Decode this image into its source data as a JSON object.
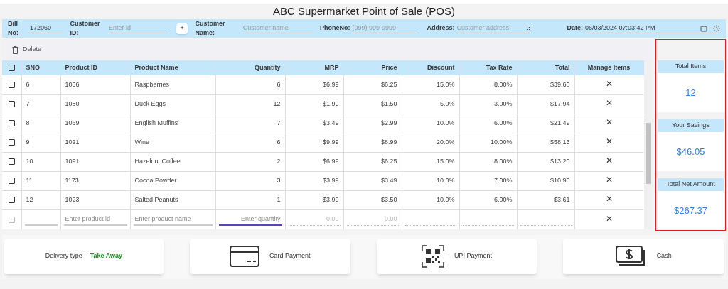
{
  "window": {
    "title": "ABC Supermarket Point of Sale (POS)"
  },
  "header": {
    "fields": [
      {
        "label": "Bill No:",
        "value": "172060"
      },
      {
        "label": "Customer ID:",
        "placeholder": "Enter id"
      },
      {
        "label": "Customer Name:",
        "placeholder": "Customer name"
      },
      {
        "label": "PhoneNo:",
        "placeholder": "(999) 999-9999"
      },
      {
        "label": "Address:",
        "placeholder": "Customer address"
      },
      {
        "label": "Date:",
        "value": "06/03/2024 07:03:42 PM"
      }
    ],
    "add_button": "+"
  },
  "toolbar": {
    "delete": "Delete"
  },
  "table": {
    "select_all": {
      "checked": false
    },
    "columns": [
      "SNO",
      "Product ID",
      "Product Name",
      "Quantity",
      "MRP",
      "Price",
      "Discount",
      "Tax Rate",
      "Total",
      "Manage Items"
    ],
    "rows": [
      {
        "checked": false,
        "cells": [
          "6",
          "1036",
          "Raspberries",
          "6",
          "$6.99",
          "$6.25",
          "15.0%",
          "8.00%",
          "$39.60"
        ],
        "remove": "✕"
      },
      {
        "checked": false,
        "cells": [
          "7",
          "1080",
          "Duck Eggs",
          "12",
          "$1.99",
          "$1.50",
          "5.0%",
          "3.00%",
          "$17.94"
        ],
        "remove": "✕"
      },
      {
        "checked": false,
        "cells": [
          "8",
          "1069",
          "English Muffins",
          "7",
          "$3.49",
          "$2.99",
          "10.0%",
          "6.00%",
          "$21.49"
        ],
        "remove": "✕"
      },
      {
        "checked": false,
        "cells": [
          "9",
          "1021",
          "Wine",
          "6",
          "$9.99",
          "$8.99",
          "20.0%",
          "10.00%",
          "$58.13"
        ],
        "remove": "✕"
      },
      {
        "checked": false,
        "cells": [
          "10",
          "1091",
          "Hazelnut Coffee",
          "2",
          "$6.99",
          "$6.25",
          "15.0%",
          "8.00%",
          "$13.20"
        ],
        "remove": "✕"
      },
      {
        "checked": false,
        "cells": [
          "11",
          "1173",
          "Cocoa Powder",
          "3",
          "$3.99",
          "$3.49",
          "10.0%",
          "7.00%",
          "$10.90"
        ],
        "remove": "✕"
      },
      {
        "checked": false,
        "cells": [
          "12",
          "1023",
          "Salted Peanuts",
          "1",
          "$3.99",
          "$3.50",
          "10.0%",
          "6.00%",
          "$3.61"
        ],
        "remove": "✕"
      }
    ],
    "new_row": {
      "checked": false,
      "product_id": "Enter product id",
      "product_name": "Enter product name",
      "quantity": "Enter quantity",
      "mrp": "0.00",
      "price": "0.00",
      "remove": "✕"
    }
  },
  "summary": [
    {
      "label": "Total Items",
      "value": "12"
    },
    {
      "label": "Your Savings",
      "value": "$46.05"
    },
    {
      "label": "Total Net Amount",
      "value": "$267.37"
    }
  ],
  "footer": {
    "delivery_label": "Delivery type :",
    "delivery_value": "Take Away",
    "payments": [
      {
        "kind": "card",
        "label": "Card Payment"
      },
      {
        "kind": "upi",
        "label": "UPI Payment"
      },
      {
        "kind": "cash",
        "label": "Cash"
      }
    ]
  }
}
